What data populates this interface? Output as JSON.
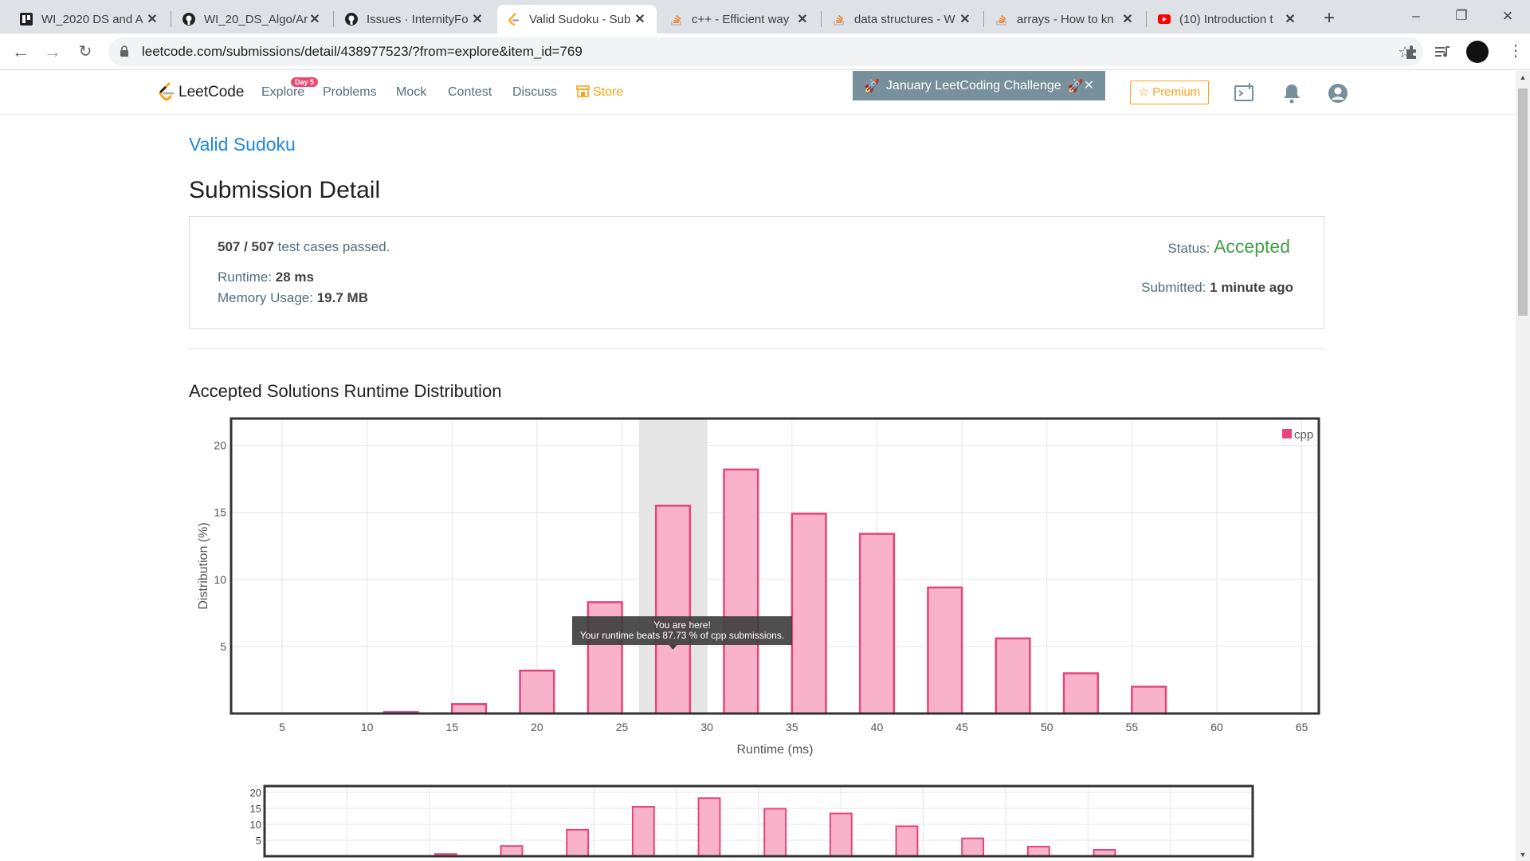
{
  "browser": {
    "tabs": [
      {
        "title": "WI_2020 DS and A",
        "icon": "trello-icon"
      },
      {
        "title": "WI_20_DS_Algo/Ar",
        "icon": "github-icon"
      },
      {
        "title": "Issues · InternityFo",
        "icon": "github-icon"
      },
      {
        "title": "Valid Sudoku - Sub",
        "icon": "leetcode-icon"
      },
      {
        "title": "c++ - Efficient way",
        "icon": "stackoverflow-icon"
      },
      {
        "title": "data structures - W",
        "icon": "stackoverflow-icon"
      },
      {
        "title": "arrays - How to kn",
        "icon": "stackoverflow-icon"
      },
      {
        "title": "(10) Introduction t",
        "icon": "youtube-icon"
      }
    ],
    "url": "leetcode.com/submissions/detail/438977523/?from=explore&item_id=769"
  },
  "nav": {
    "logo": "LeetCode",
    "explore": "Explore",
    "explore_badge": "Day 5",
    "problems": "Problems",
    "mock": "Mock",
    "contest": "Contest",
    "discuss": "Discuss",
    "store": "Store",
    "challenge": "January LeetCoding Challenge",
    "premium": "Premium"
  },
  "submission": {
    "problem_title": "Valid Sudoku",
    "heading": "Submission Detail",
    "passed": "507 / 507",
    "passed_suffix": "test cases passed.",
    "runtime_label": "Runtime:",
    "runtime": "28 ms",
    "memory_label": "Memory Usage:",
    "memory": "19.7 MB",
    "status_label": "Status:",
    "status": "Accepted",
    "submitted_label": "Submitted:",
    "submitted": "1 minute ago"
  },
  "section_title": "Accepted Solutions Runtime Distribution",
  "tooltip": {
    "line1": "You are here!",
    "line2": "Your runtime beats 87.73 % of cpp submissions."
  },
  "colors": {
    "bar_fill": "#f8b3cb",
    "bar_stroke": "#e5457a",
    "accent": "#ffa116",
    "accepted": "#43a047"
  },
  "chart_data": {
    "type": "bar",
    "title": "",
    "xlabel": "Runtime (ms)",
    "ylabel": "Distribution (%)",
    "xlim": [
      2,
      66
    ],
    "ylim": [
      0,
      22
    ],
    "xticks": [
      5,
      10,
      15,
      20,
      25,
      30,
      35,
      40,
      45,
      50,
      55,
      60,
      65
    ],
    "yticks": [
      5,
      10,
      15,
      20
    ],
    "highlight_range": [
      26,
      30
    ],
    "legend": "top-right",
    "series": [
      {
        "name": "cpp",
        "x": [
          12,
          16,
          20,
          24,
          28,
          32,
          36,
          40,
          44,
          48,
          52,
          56
        ],
        "values": [
          0.1,
          0.7,
          3.2,
          8.3,
          15.5,
          18.2,
          14.9,
          13.4,
          9.4,
          5.6,
          3.0,
          2.0
        ]
      }
    ]
  }
}
